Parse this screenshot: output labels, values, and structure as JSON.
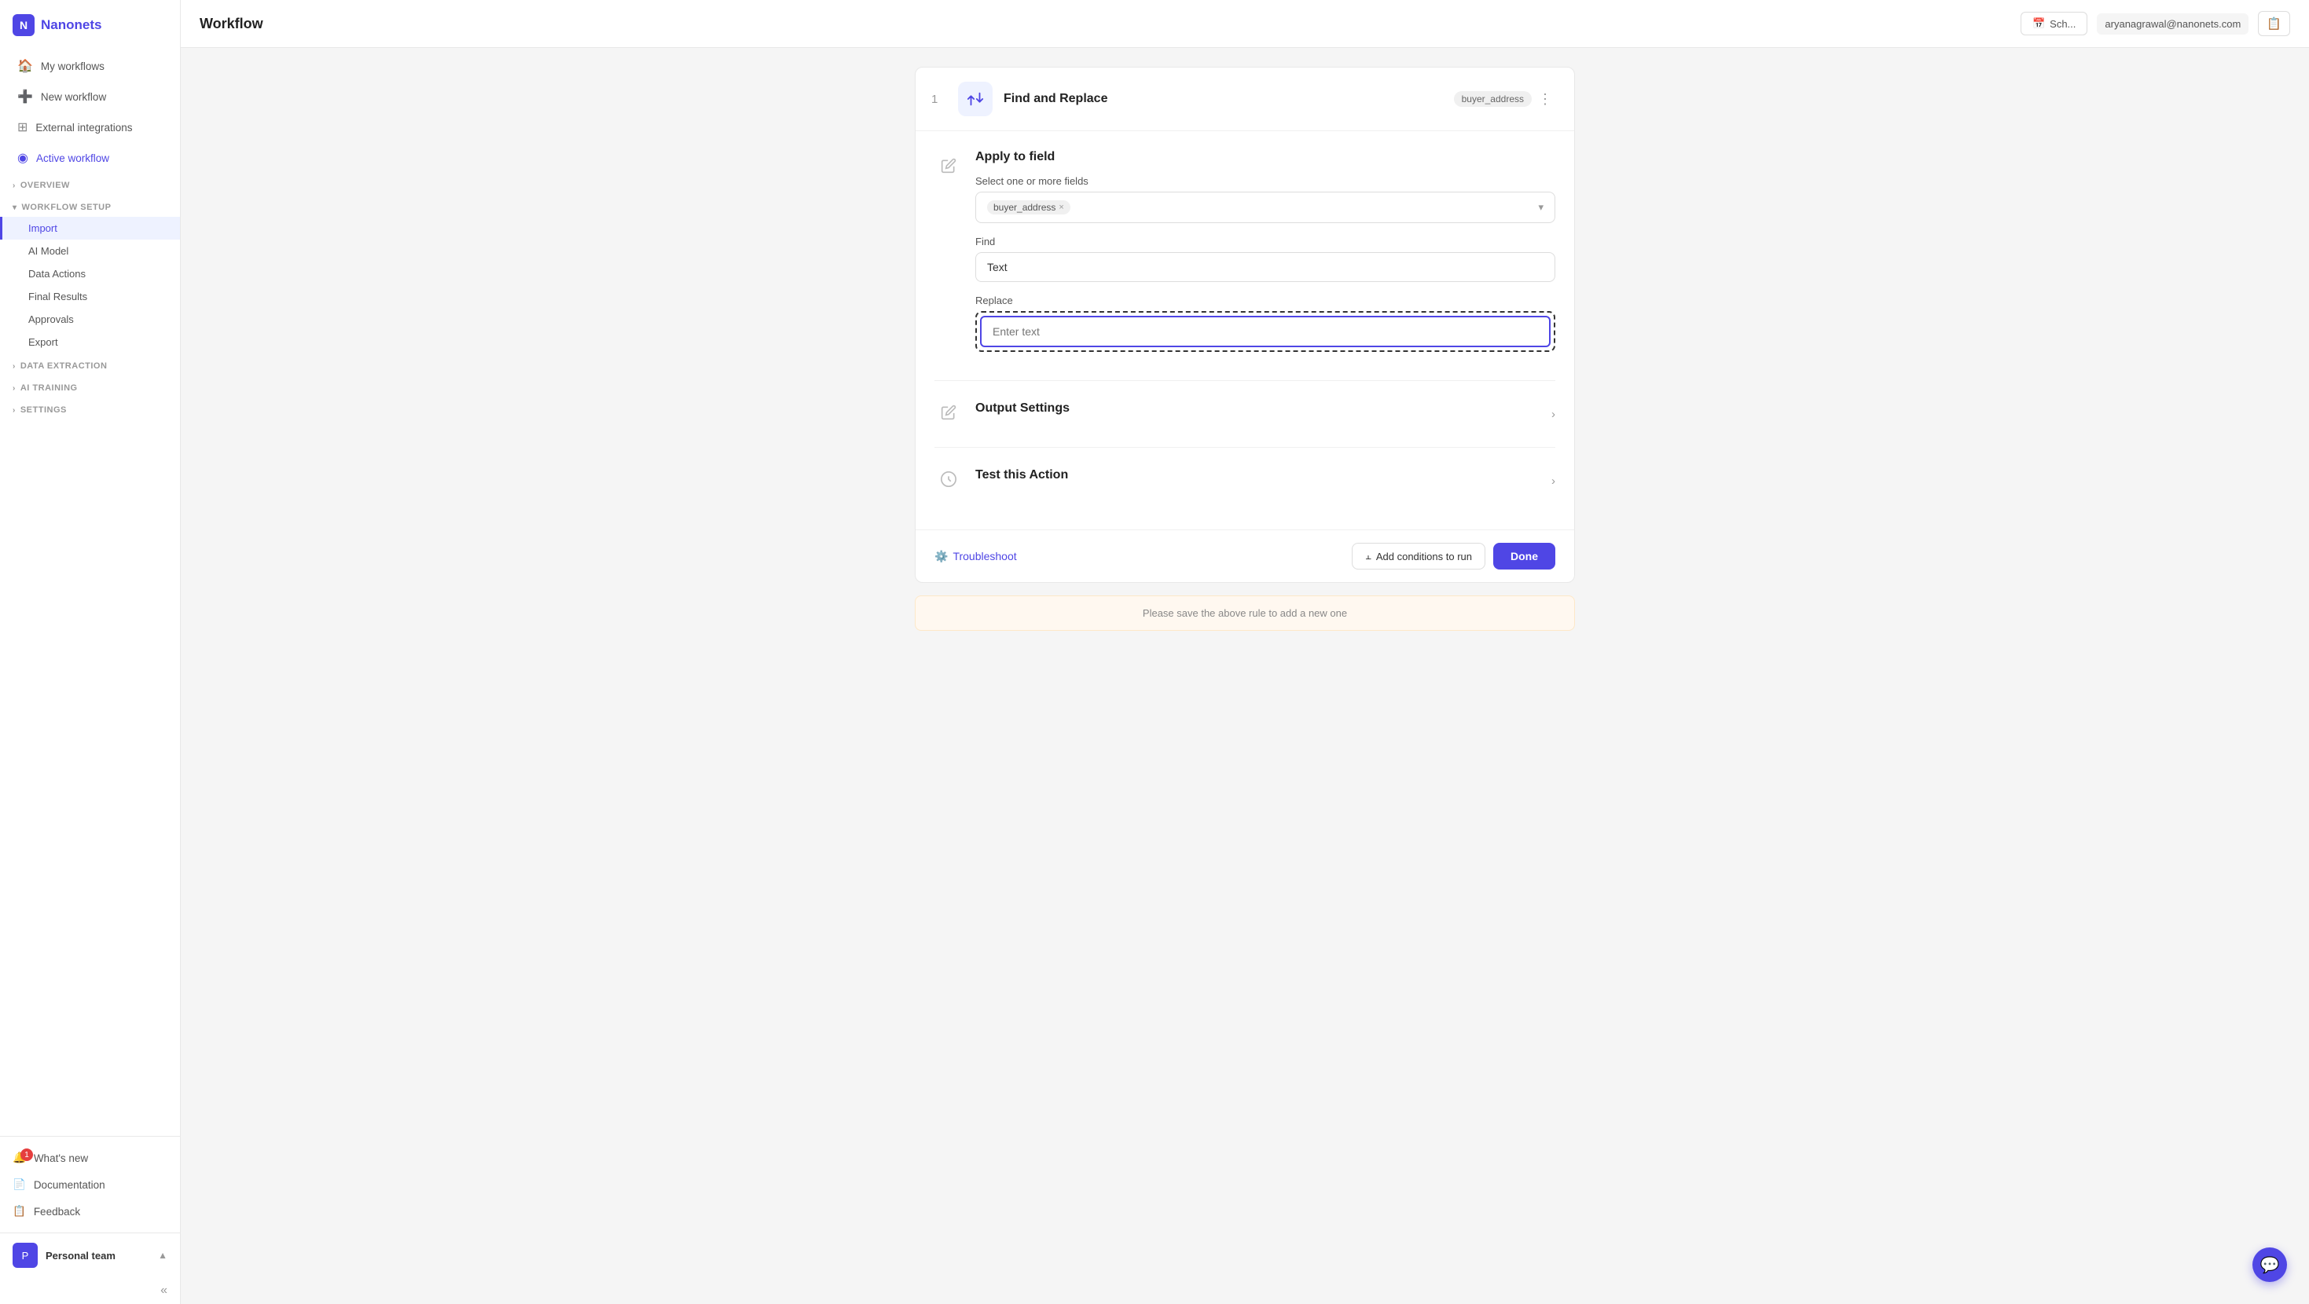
{
  "app": {
    "name": "Nanonets",
    "page_title": "Workflow"
  },
  "topbar": {
    "title": "Workflow",
    "schedule_btn": "Sch...",
    "user_email": "aryanagrawal@nanonets.com",
    "copy_icon": "📋"
  },
  "sidebar": {
    "logo_text": "Nanonets",
    "nav_items": [
      {
        "id": "my-workflows",
        "label": "My workflows",
        "icon": "🏠"
      },
      {
        "id": "new-workflow",
        "label": "New workflow",
        "icon": "➕"
      },
      {
        "id": "external-integrations",
        "label": "External integrations",
        "icon": "⊞"
      },
      {
        "id": "active-workflow",
        "label": "Active workflow",
        "icon": "◉"
      }
    ],
    "sections": [
      {
        "id": "overview",
        "label": "OVERVIEW",
        "collapsed": true
      },
      {
        "id": "workflow-setup",
        "label": "WORKFLOW SETUP",
        "collapsed": false,
        "sub_items": [
          {
            "id": "import",
            "label": "Import",
            "active": true
          },
          {
            "id": "ai-model",
            "label": "AI Model"
          },
          {
            "id": "data-actions",
            "label": "Data Actions"
          },
          {
            "id": "final-results",
            "label": "Final Results"
          },
          {
            "id": "approvals",
            "label": "Approvals"
          },
          {
            "id": "export",
            "label": "Export"
          }
        ]
      },
      {
        "id": "data-extraction",
        "label": "DATA EXTRACTION",
        "collapsed": true
      },
      {
        "id": "ai-training",
        "label": "AI TRAINING",
        "collapsed": true
      },
      {
        "id": "settings",
        "label": "SETTINGS",
        "collapsed": true
      }
    ],
    "bottom_items": [
      {
        "id": "whats-new",
        "label": "What's new",
        "icon": "🔔",
        "badge": "1"
      },
      {
        "id": "documentation",
        "label": "Documentation",
        "icon": "📄"
      },
      {
        "id": "feedback",
        "label": "Feedback",
        "icon": "📋"
      }
    ],
    "team": {
      "name": "Personal team",
      "icon_text": "P"
    },
    "collapse_icon": "«"
  },
  "workflow_card": {
    "number": "1",
    "icon": "🔄",
    "title": "Find and Replace",
    "tag": "buyer_address",
    "menu_icon": "⋮",
    "sections": {
      "apply_to_field": {
        "title": "Apply to field",
        "field_label": "Select one or more fields",
        "field_value": "buyer_address",
        "remove_icon": "×",
        "chevron_icon": "▾"
      },
      "find": {
        "label": "Find",
        "value": "Text",
        "placeholder": "Text"
      },
      "replace": {
        "label": "Replace",
        "placeholder": "Enter text",
        "value": ""
      },
      "output_settings": {
        "title": "Output Settings",
        "chevron": "›"
      },
      "test_action": {
        "title": "Test this Action",
        "chevron": "›"
      }
    },
    "footer": {
      "troubleshoot_icon": "⚙",
      "troubleshoot_label": "Troubleshoot",
      "conditions_icon": "⫠",
      "conditions_label": "Add conditions to run",
      "done_label": "Done"
    },
    "save_notice": "Please save the above rule to add a new one"
  },
  "chat_icon": "💬"
}
